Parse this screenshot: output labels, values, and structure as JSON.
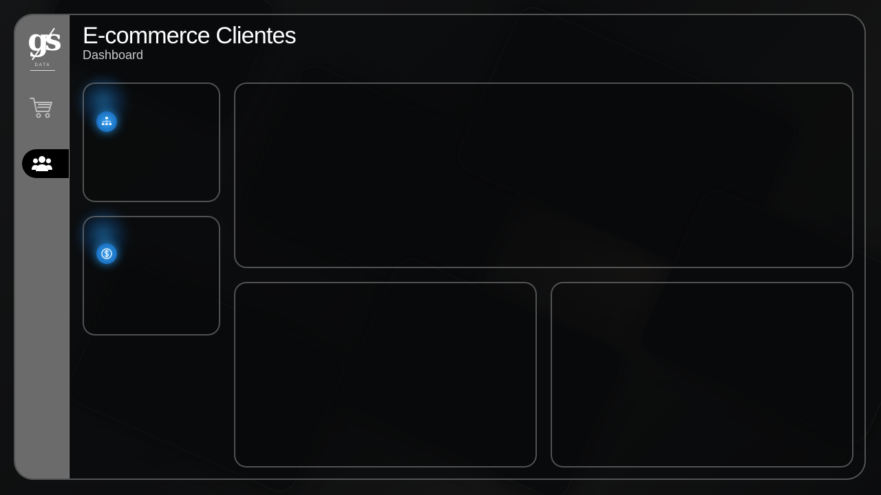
{
  "app": {
    "title": "E-commerce Clientes",
    "subtitle": "Dashboard"
  },
  "logo": {
    "mark": "gs",
    "word": "DATA"
  },
  "sidebar": {
    "items": [
      {
        "name": "ventas",
        "icon": "cart-icon",
        "active": false
      },
      {
        "name": "clientes",
        "icon": "users-icon",
        "active": true
      }
    ]
  },
  "kpis": [
    {
      "icon": "hierarchy-icon"
    },
    {
      "icon": "dollar-coin-icon"
    }
  ],
  "colors": {
    "accent": "#2a90e0",
    "sidebar": "#6b6b6b",
    "card_border": "#8a8a8a",
    "text": "#ffffff",
    "subtext": "#c8c8c8"
  }
}
